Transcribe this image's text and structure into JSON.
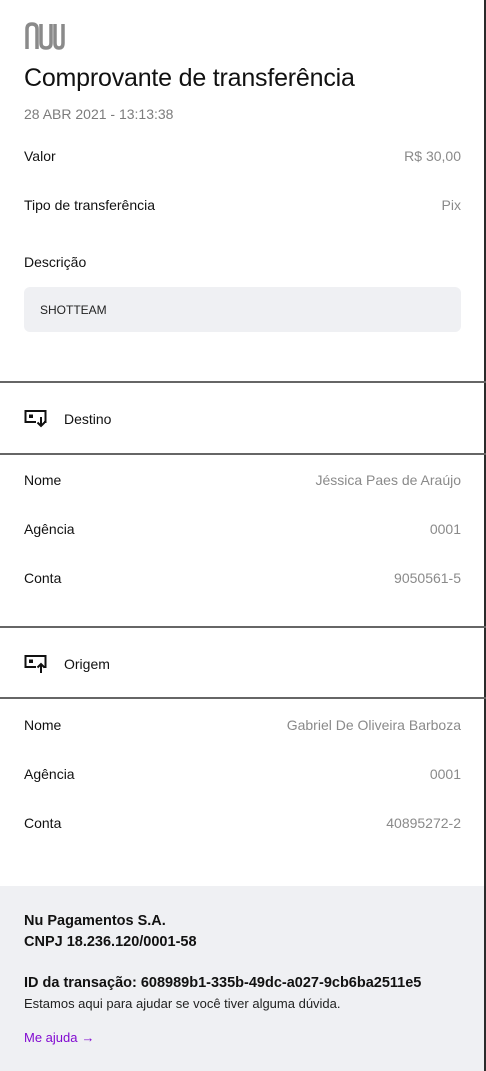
{
  "header": {
    "logo_icon": "nubank-logo-icon",
    "title": "Comprovante de transferência",
    "date": "28 ABR 2021 - 13:13:38"
  },
  "summary": {
    "valor": {
      "label": "Valor",
      "value": "R$ 30,00"
    },
    "tipo": {
      "label": "Tipo de transferência",
      "value": "Pix"
    },
    "descricao_label": "Descrição",
    "descricao_value": "SHOTTEAM"
  },
  "destino": {
    "icon": "bank-transfer-in-icon",
    "heading": "Destino",
    "nome": {
      "label": "Nome",
      "value": "Jéssica Paes de Araújo"
    },
    "agencia": {
      "label": "Agência",
      "value": "0001"
    },
    "conta": {
      "label": "Conta",
      "value": "9050561-5"
    }
  },
  "origem": {
    "icon": "bank-transfer-out-icon",
    "heading": "Origem",
    "nome": {
      "label": "Nome",
      "value": "Gabriel De Oliveira Barboza"
    },
    "agencia": {
      "label": "Agência",
      "value": "0001"
    },
    "conta": {
      "label": "Conta",
      "value": "40895272-2"
    }
  },
  "footer": {
    "company": "Nu Pagamentos S.A.",
    "cnpj": "CNPJ 18.236.120/0001-58",
    "transaction_id": "ID da transação: 608989b1-335b-49dc-a027-9cb6ba2511e5",
    "help_text": "Estamos aqui para ajudar se você tiver alguma dúvida.",
    "help_link": "Me ajuda",
    "help_link_arrow": "→"
  },
  "colors": {
    "accent_purple": "#820ad1",
    "text_primary": "#111111",
    "text_secondary": "#8a8a8a",
    "panel_bg": "#eff0f3",
    "divider": "#666666"
  }
}
